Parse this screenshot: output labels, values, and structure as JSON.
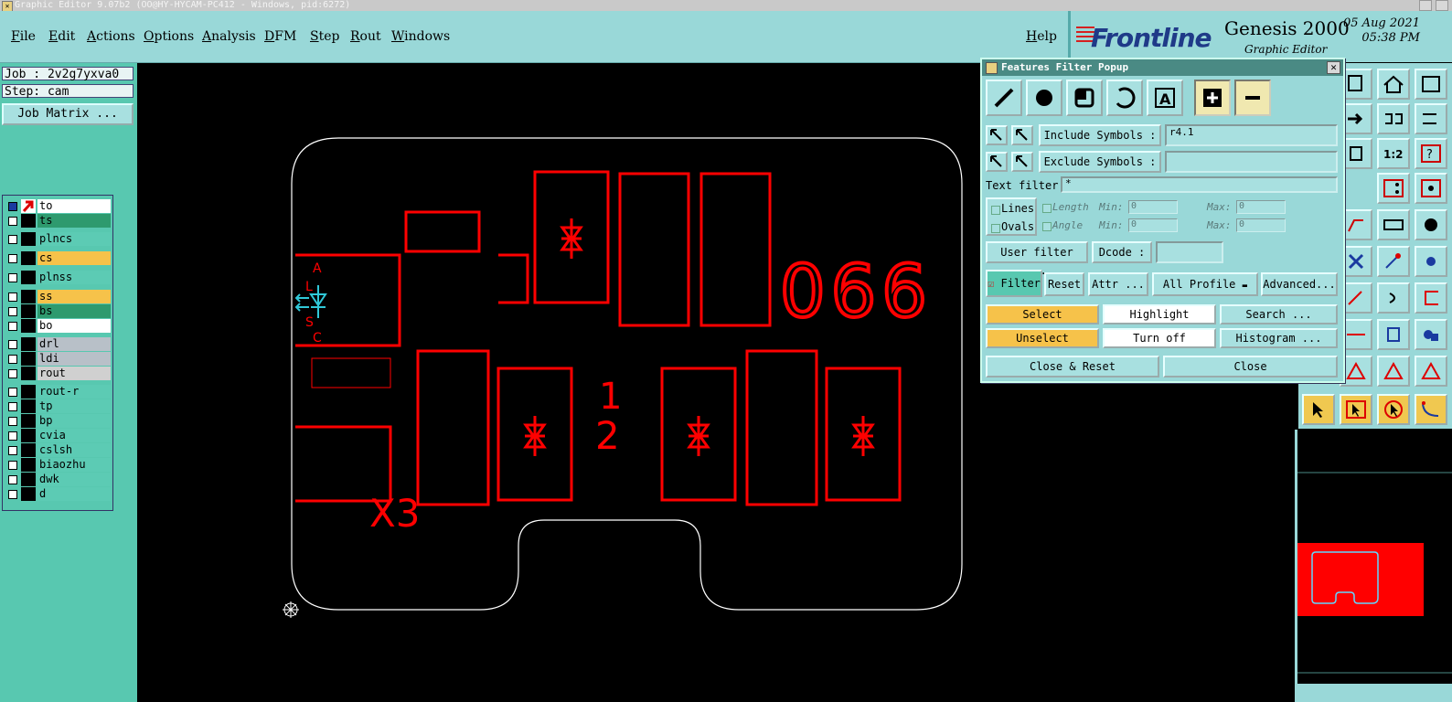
{
  "window": {
    "title": "Graphic Editor 9.07b2 (OO@HY-HYCAM-PC412 - Windows, pid:6272)"
  },
  "menubar": {
    "items": [
      "File",
      "Edit",
      "Actions",
      "Options",
      "Analysis",
      "DFM",
      "Step",
      "Rout",
      "Windows"
    ],
    "help": "Help"
  },
  "brand": {
    "frontline": "Frontline",
    "product": "Genesis 2000",
    "subtitle": "Graphic Editor",
    "date": "05 Aug 2021",
    "time": "05:38 PM"
  },
  "leftpanel": {
    "job": "Job : 2v2g7yxva0",
    "step": "Step: cam",
    "job_matrix": "Job Matrix ...",
    "layers": [
      {
        "name": "to",
        "color": "#ffffff",
        "work": true
      },
      {
        "name": "ts",
        "color": "#2e9a6e"
      },
      {
        "name": "plncs",
        "color": "#5ccbb4"
      },
      {
        "name": "cs",
        "color": "#f6c24a"
      },
      {
        "name": "plnss",
        "color": "#5ccbb4"
      },
      {
        "name": "ss",
        "color": "#f6c24a"
      },
      {
        "name": "bs",
        "color": "#2e9a6e"
      },
      {
        "name": "bo",
        "color": "#ffffff"
      },
      {
        "name": "drl",
        "color": "#b8c0c8"
      },
      {
        "name": "ldi",
        "color": "#b8c0c8"
      },
      {
        "name": "rout",
        "color": "#d0d0d0"
      },
      {
        "name": "rout-r",
        "color": "#5ccbb4"
      },
      {
        "name": "tp",
        "color": "#5ccbb4"
      },
      {
        "name": "bp",
        "color": "#5ccbb4"
      },
      {
        "name": "cvia",
        "color": "#5ccbb4"
      },
      {
        "name": "cslsh",
        "color": "#5ccbb4"
      },
      {
        "name": "biaozhu",
        "color": "#5ccbb4"
      },
      {
        "name": "dwk",
        "color": "#5ccbb4"
      },
      {
        "name": "d",
        "color": "#5ccbb4"
      }
    ]
  },
  "canvas": {
    "texts": {
      "number": "066",
      "label_1": "1",
      "label_2": "2",
      "label_x3": "X3",
      "a": "A",
      "l": "L",
      "s": "S",
      "c": "C"
    }
  },
  "popup": {
    "title": "Features Filter Popup",
    "include_label": "Include Symbols :",
    "include_value": "r4.1",
    "exclude_label": "Exclude Symbols :",
    "exclude_value": "",
    "text_filter_label": "Text filter",
    "text_filter_value": "*",
    "lines": "Lines",
    "ovals": "Ovals",
    "length": "Length",
    "angle": "Angle",
    "min": "Min:",
    "max": "Max:",
    "length_min": "0",
    "length_max": "0",
    "angle_min": "0",
    "angle_max": "0",
    "user_filter": "User filter ...",
    "dcode": "Dcode :",
    "filter": "Filter",
    "reset": "Reset",
    "attr": "Attr ...",
    "all_profile": "All Profile",
    "advanced": "Advanced...",
    "select": "Select",
    "highlight": "Highlight",
    "search": "Search ...",
    "unselect": "Unselect",
    "turn_off": "Turn off",
    "histogram": "Histogram ...",
    "close_reset": "Close & Reset",
    "close": "Close"
  },
  "colors": {
    "feature_red": "#ff0000",
    "profile_white": "#ffffff",
    "panel_teal": "#99d8d8",
    "layer_green": "#58c8b0",
    "highlight_yellow": "#f6c24a"
  }
}
